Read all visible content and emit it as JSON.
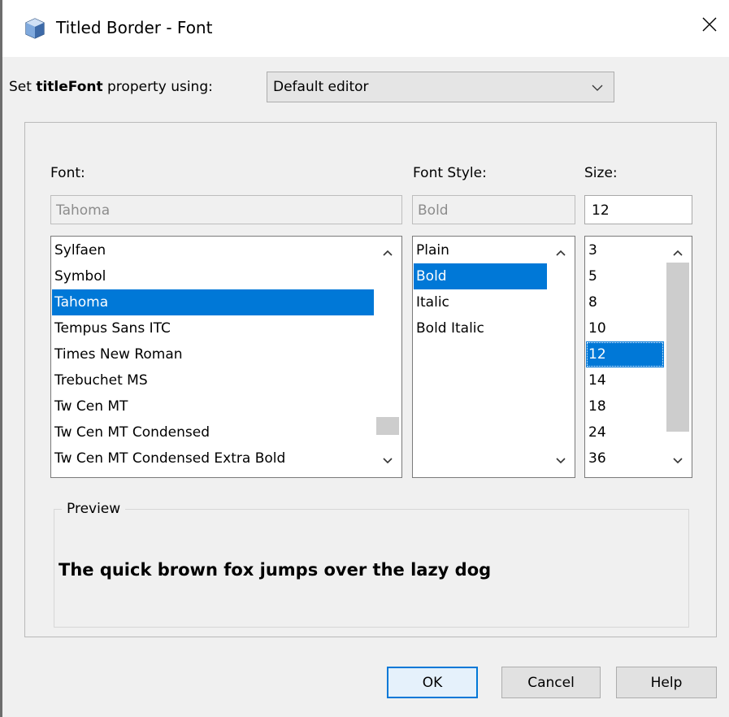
{
  "window": {
    "title": "Titled Border - Font",
    "icon": "cube-icon",
    "close_icon": "close-icon"
  },
  "property_row": {
    "prefix": "Set ",
    "property_name": "titleFont",
    "suffix": " property using:",
    "editor_selected": "Default editor"
  },
  "font_panel": {
    "font_label": "Font:",
    "style_label": "Font Style:",
    "size_label": "Size:",
    "font_value": "Tahoma",
    "style_value": "Bold",
    "size_value": "12",
    "fonts": [
      {
        "label": "Sylfaen",
        "selected": false
      },
      {
        "label": "Symbol",
        "selected": false
      },
      {
        "label": "Tahoma",
        "selected": true
      },
      {
        "label": "Tempus Sans ITC",
        "selected": false
      },
      {
        "label": "Times New Roman",
        "selected": false
      },
      {
        "label": "Trebuchet MS",
        "selected": false
      },
      {
        "label": "Tw Cen MT",
        "selected": false
      },
      {
        "label": "Tw Cen MT Condensed",
        "selected": false
      },
      {
        "label": "Tw Cen MT Condensed Extra Bold",
        "selected": false
      }
    ],
    "styles": [
      {
        "label": "Plain",
        "selected": false
      },
      {
        "label": "Bold",
        "selected": true
      },
      {
        "label": "Italic",
        "selected": false
      },
      {
        "label": "Bold Italic",
        "selected": false
      }
    ],
    "sizes": [
      {
        "label": "3",
        "selected": false
      },
      {
        "label": "5",
        "selected": false
      },
      {
        "label": "8",
        "selected": false
      },
      {
        "label": "10",
        "selected": false
      },
      {
        "label": "12",
        "selected": true
      },
      {
        "label": "14",
        "selected": false
      },
      {
        "label": "18",
        "selected": false
      },
      {
        "label": "24",
        "selected": false
      },
      {
        "label": "36",
        "selected": false
      }
    ]
  },
  "preview": {
    "legend": "Preview",
    "sample_text": "The quick brown fox jumps over the lazy dog"
  },
  "buttons": {
    "ok": "OK",
    "cancel": "Cancel",
    "help": "Help"
  },
  "colors": {
    "selection": "#0078d7",
    "dialog_background": "#f0f0f0",
    "default_button_border": "#0078d7"
  }
}
